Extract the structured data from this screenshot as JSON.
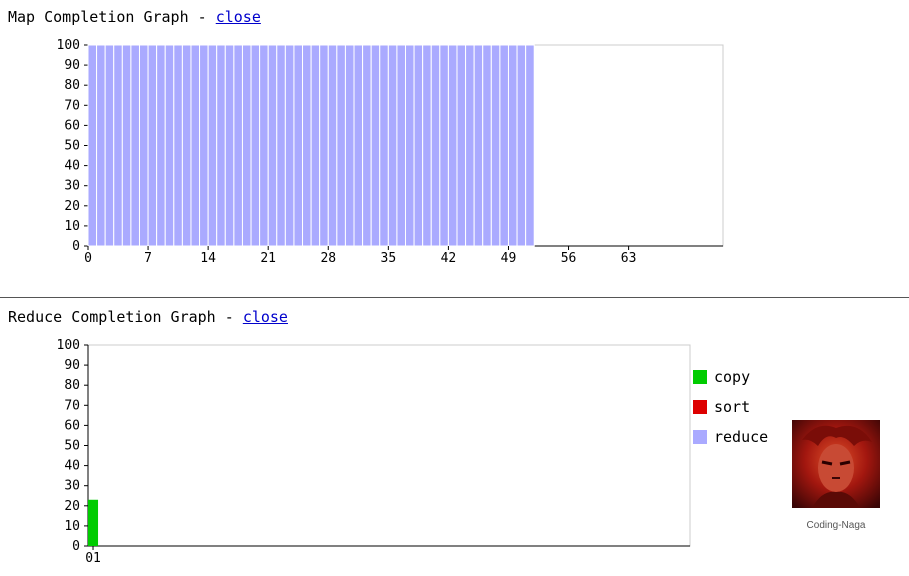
{
  "map_section": {
    "title": "Map Completion Graph - ",
    "close_label": "close"
  },
  "reduce_section": {
    "title": "Reduce Completion Graph - ",
    "close_label": "close"
  },
  "legend": [
    {
      "label": "copy",
      "color": "#00cc00"
    },
    {
      "label": "sort",
      "color": "#dd0000"
    },
    {
      "label": "reduce",
      "color": "#aaaaff"
    }
  ],
  "avatar": {
    "caption": "Coding-Naga"
  },
  "chart_data": [
    {
      "type": "bar",
      "title": "Map Completion Graph",
      "ylim": [
        0,
        100
      ],
      "yticks": [
        0,
        10,
        20,
        30,
        40,
        50,
        60,
        70,
        80,
        90,
        100
      ],
      "xlim": [
        0,
        74
      ],
      "xticks": [
        0,
        7,
        14,
        21,
        28,
        35,
        42,
        49,
        56,
        63
      ],
      "tick_labels": [
        "0",
        "7",
        "14",
        "21",
        "28",
        "35",
        "42",
        "49",
        "56",
        "63"
      ],
      "bar_color": "#aaaaff",
      "x": [
        0,
        1,
        2,
        3,
        4,
        5,
        6,
        7,
        8,
        9,
        10,
        11,
        12,
        13,
        14,
        15,
        16,
        17,
        18,
        19,
        20,
        21,
        22,
        23,
        24,
        25,
        26,
        27,
        28,
        29,
        30,
        31,
        32,
        33,
        34,
        35,
        36,
        37,
        38,
        39,
        40,
        41,
        42,
        43,
        44,
        45,
        46,
        47,
        48,
        49,
        50,
        51
      ],
      "values": [
        100,
        100,
        100,
        100,
        100,
        100,
        100,
        100,
        100,
        100,
        100,
        100,
        100,
        100,
        100,
        100,
        100,
        100,
        100,
        100,
        100,
        100,
        100,
        100,
        100,
        100,
        100,
        100,
        100,
        100,
        100,
        100,
        100,
        100,
        100,
        100,
        100,
        100,
        100,
        100,
        100,
        100,
        100,
        100,
        100,
        100,
        100,
        100,
        100,
        100,
        100,
        100
      ]
    },
    {
      "type": "bar",
      "title": "Reduce Completion Graph",
      "ylim": [
        0,
        100
      ],
      "yticks": [
        0,
        10,
        20,
        30,
        40,
        50,
        60,
        70,
        80,
        90,
        100
      ],
      "xlim": [
        0,
        60
      ],
      "tick_labels": [
        "01"
      ],
      "series": [
        {
          "name": "copy",
          "color": "#00cc00",
          "values": [
            23
          ]
        },
        {
          "name": "sort",
          "color": "#dd0000",
          "values": [
            0
          ]
        },
        {
          "name": "reduce",
          "color": "#aaaaff",
          "values": [
            0
          ]
        }
      ]
    }
  ]
}
